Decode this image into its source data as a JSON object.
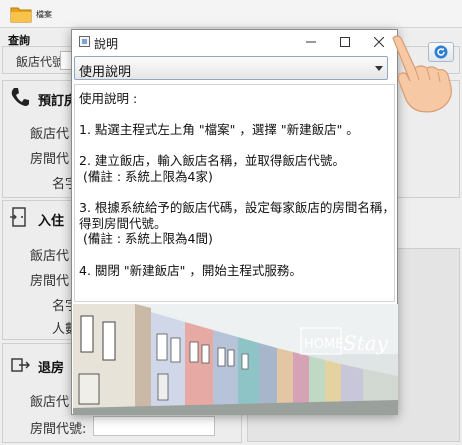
{
  "menubar": {
    "file_menu": "檔案"
  },
  "query": {
    "title": "查詢",
    "hotel_code_label": "飯店代號:"
  },
  "booking": {
    "title": "預訂房",
    "hotel_code_label": "飯店代",
    "room_code_label": "房間代",
    "name_label": "名字"
  },
  "checkin": {
    "title": "入住",
    "hotel_code_label": "飯店代",
    "room_code_label": "房間代",
    "name_label": "名字",
    "people_label": "人數"
  },
  "checkout": {
    "title": "退房",
    "hotel_code_label": "飯店代",
    "room_code_label": "房間代號:"
  },
  "dialog": {
    "title": "說明",
    "combo_selected": "使用說明",
    "lines": [
      "使用說明 :",
      "",
      "1. 點選主程式左上角 \"檔案\" ，選擇 \"新建飯店\" 。",
      "",
      "2. 建立飯店，輸入飯店名稱，並取得飯店代號。",
      " (備註 : 系統上限為4家)",
      "",
      "3. 根據系統給予的飯店代碼，設定每家飯店的房間名稱，並",
      "得到房間代號。",
      " (備註 : 系統上限為4間)",
      "",
      "4. 關閉 \"新建飯店\" ，開始主程式服務。"
    ],
    "banner_text_left": "HOME",
    "banner_text_right": "Stay"
  },
  "colors": {
    "accent": "#2d7fd3",
    "combo_border": "#8ea7c4"
  }
}
